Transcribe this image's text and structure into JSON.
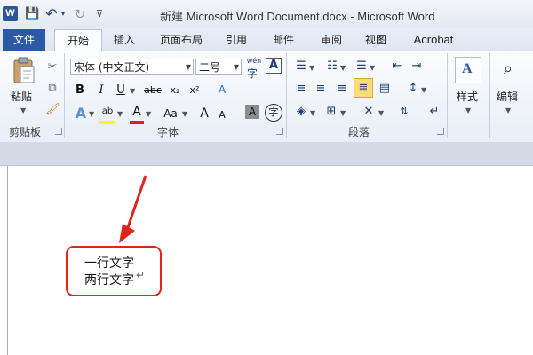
{
  "window": {
    "title": "新建 Microsoft Word Document.docx - Microsoft Word",
    "app_logo": "W",
    "quick_access": [
      {
        "icon": "save-icon",
        "glyph": "💾"
      },
      {
        "icon": "undo-icon",
        "glyph": "↶"
      },
      {
        "icon": "undo-dropdown-icon",
        "glyph": "▾"
      },
      {
        "icon": "redo-icon",
        "glyph": "↻"
      },
      {
        "icon": "customize-quick-access-icon",
        "glyph": "⊽"
      }
    ]
  },
  "tabs": {
    "file": "文件",
    "home": "开始",
    "insert": "插入",
    "page_layout": "页面布局",
    "references": "引用",
    "mailings": "邮件",
    "review": "审阅",
    "view": "视图",
    "acrobat": "Acrobat"
  },
  "clipboard": {
    "paste_label": "粘贴",
    "group_label": "剪贴板"
  },
  "font": {
    "font_name": "宋体 (中文正文)",
    "font_size": "二号",
    "group_label": "字体",
    "phonetic_glyph": "wén",
    "char_border_glyph": "A",
    "bold": "B",
    "italic": "I",
    "underline": "U",
    "strikethrough": "abc",
    "subscript": "x₂",
    "superscript": "x²",
    "clear_format_glyph": "A",
    "text_effects": "A",
    "highlight": "ab",
    "font_color": "A",
    "change_case": "Aa",
    "grow_font": "A",
    "shrink_font": "A",
    "char_shading": "A",
    "enclose_char": "字"
  },
  "paragraph": {
    "group_label": "段落"
  },
  "styles": {
    "label": "样式"
  },
  "editing": {
    "label": "编辑"
  },
  "document": {
    "line1": "一行文字",
    "line2": "两行文字",
    "paragraph_mark": "↵"
  },
  "colors": {
    "file_tab": "#2a5aa5",
    "annotation": "#e0251d",
    "highlight": "#ffff00",
    "font_color": "#e02020"
  }
}
